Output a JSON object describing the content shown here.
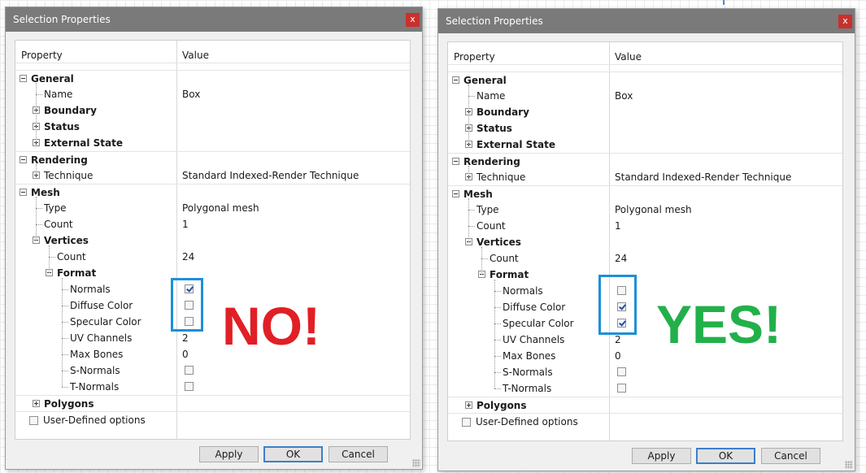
{
  "colors": {
    "titlebar": "#7a7a7a",
    "close": "#c9302c",
    "highlight": "#1e8fd8",
    "no_text": "#e11f26",
    "yes_text": "#22b04a"
  },
  "dialogs": [
    {
      "title": "Selection Properties",
      "close_label": "x",
      "header": {
        "property": "Property",
        "value": "Value"
      },
      "rows": [
        {
          "label": "General",
          "value": ""
        },
        {
          "label": "Name",
          "value": "Box"
        },
        {
          "label": "Boundary",
          "value": ""
        },
        {
          "label": "Status",
          "value": ""
        },
        {
          "label": "External State",
          "value": ""
        },
        {
          "label": "Rendering",
          "value": ""
        },
        {
          "label": "Technique",
          "value": "Standard Indexed-Render Technique"
        },
        {
          "label": "Mesh",
          "value": ""
        },
        {
          "label": "Type",
          "value": "Polygonal mesh"
        },
        {
          "label": "Count",
          "value": "1"
        },
        {
          "label": "Vertices",
          "value": ""
        },
        {
          "label": "Count",
          "value": "24"
        },
        {
          "label": "Format",
          "value": ""
        },
        {
          "label": "Normals",
          "checked": true
        },
        {
          "label": "Diffuse Color",
          "checked": false
        },
        {
          "label": "Specular Color",
          "checked": false
        },
        {
          "label": "UV Channels",
          "value": "2"
        },
        {
          "label": "Max Bones",
          "value": "0"
        },
        {
          "label": "S-Normals",
          "checked": false
        },
        {
          "label": "T-Normals",
          "checked": false
        },
        {
          "label": "Polygons",
          "value": ""
        },
        {
          "label": "User-Defined options",
          "checked": false
        }
      ],
      "verdict": "NO!",
      "buttons": {
        "apply": "Apply",
        "ok": "OK",
        "cancel": "Cancel"
      }
    },
    {
      "title": "Selection Properties",
      "close_label": "x",
      "header": {
        "property": "Property",
        "value": "Value"
      },
      "rows": [
        {
          "label": "General",
          "value": ""
        },
        {
          "label": "Name",
          "value": "Box"
        },
        {
          "label": "Boundary",
          "value": ""
        },
        {
          "label": "Status",
          "value": ""
        },
        {
          "label": "External State",
          "value": ""
        },
        {
          "label": "Rendering",
          "value": ""
        },
        {
          "label": "Technique",
          "value": "Standard Indexed-Render Technique"
        },
        {
          "label": "Mesh",
          "value": ""
        },
        {
          "label": "Type",
          "value": "Polygonal mesh"
        },
        {
          "label": "Count",
          "value": "1"
        },
        {
          "label": "Vertices",
          "value": ""
        },
        {
          "label": "Count",
          "value": "24"
        },
        {
          "label": "Format",
          "value": ""
        },
        {
          "label": "Normals",
          "checked": false
        },
        {
          "label": "Diffuse Color",
          "checked": true
        },
        {
          "label": "Specular Color",
          "checked": true
        },
        {
          "label": "UV Channels",
          "value": "2"
        },
        {
          "label": "Max Bones",
          "value": "0"
        },
        {
          "label": "S-Normals",
          "checked": false
        },
        {
          "label": "T-Normals",
          "checked": false
        },
        {
          "label": "Polygons",
          "value": ""
        },
        {
          "label": "User-Defined options",
          "checked": false
        }
      ],
      "verdict": "YES!",
      "buttons": {
        "apply": "Apply",
        "ok": "OK",
        "cancel": "Cancel"
      }
    }
  ]
}
